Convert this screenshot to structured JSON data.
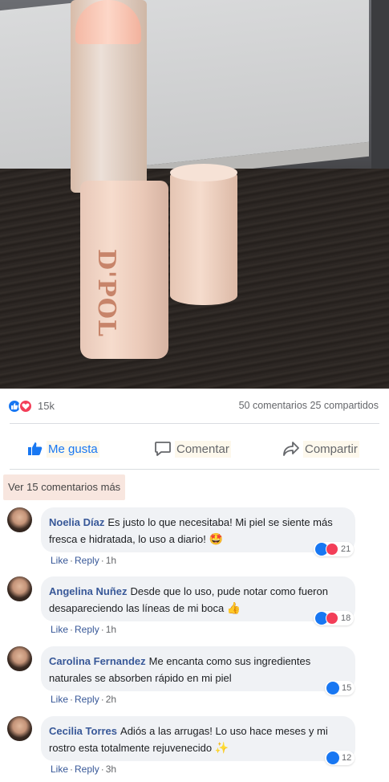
{
  "post": {
    "photo_alt": "",
    "brand_text": "D'POL"
  },
  "stats": {
    "reactions_count": "15k",
    "comments_label": "50 comentarios",
    "shares_label": "25 compartidos"
  },
  "actions": {
    "like_label": "Me gusta",
    "comment_label": "Comentar",
    "share_label": "Compartir"
  },
  "more_comments_label": "Ver 15 comentarios más",
  "comments": [
    {
      "name": "Noelia Díaz",
      "text": "Es justo lo que necesitaba! Mi piel se siente más fresca e hidratada, lo uso a diario!",
      "emoji": "🤩",
      "reactions": "21",
      "reaction_types": [
        "like-icon",
        "love-icon"
      ],
      "like_label": "Like",
      "reply_label": "Reply",
      "time": "1h"
    },
    {
      "name": "Angelina Nuñez",
      "text": "Desde que lo uso, pude notar como fueron desapareciendo las líneas de mi boca",
      "emoji": "👍",
      "reactions": "18",
      "reaction_types": [
        "like-icon",
        "love-icon"
      ],
      "like_label": "Like",
      "reply_label": "Reply",
      "time": "1h"
    },
    {
      "name": "Carolina Fernandez",
      "text": "Me encanta como sus ingredientes naturales se absorben rápido en mi piel",
      "emoji": "",
      "reactions": "15",
      "reaction_types": [
        "like-icon"
      ],
      "like_label": "Like",
      "reply_label": "Reply",
      "time": "2h"
    },
    {
      "name": "Cecilia Torres",
      "text": "Adiós a las arrugas! Lo uso hace meses y mi rostro esta totalmente rejuvenecido",
      "emoji": "✨",
      "reactions": "12",
      "reaction_types": [
        "like-icon"
      ],
      "like_label": "Like",
      "reply_label": "Reply",
      "time": "3h"
    }
  ],
  "colors": {
    "link": "#385898",
    "fb_blue": "#1877f2",
    "love_red": "#f33e58",
    "bubble_bg": "#f0f2f5",
    "muted": "#65676b"
  }
}
